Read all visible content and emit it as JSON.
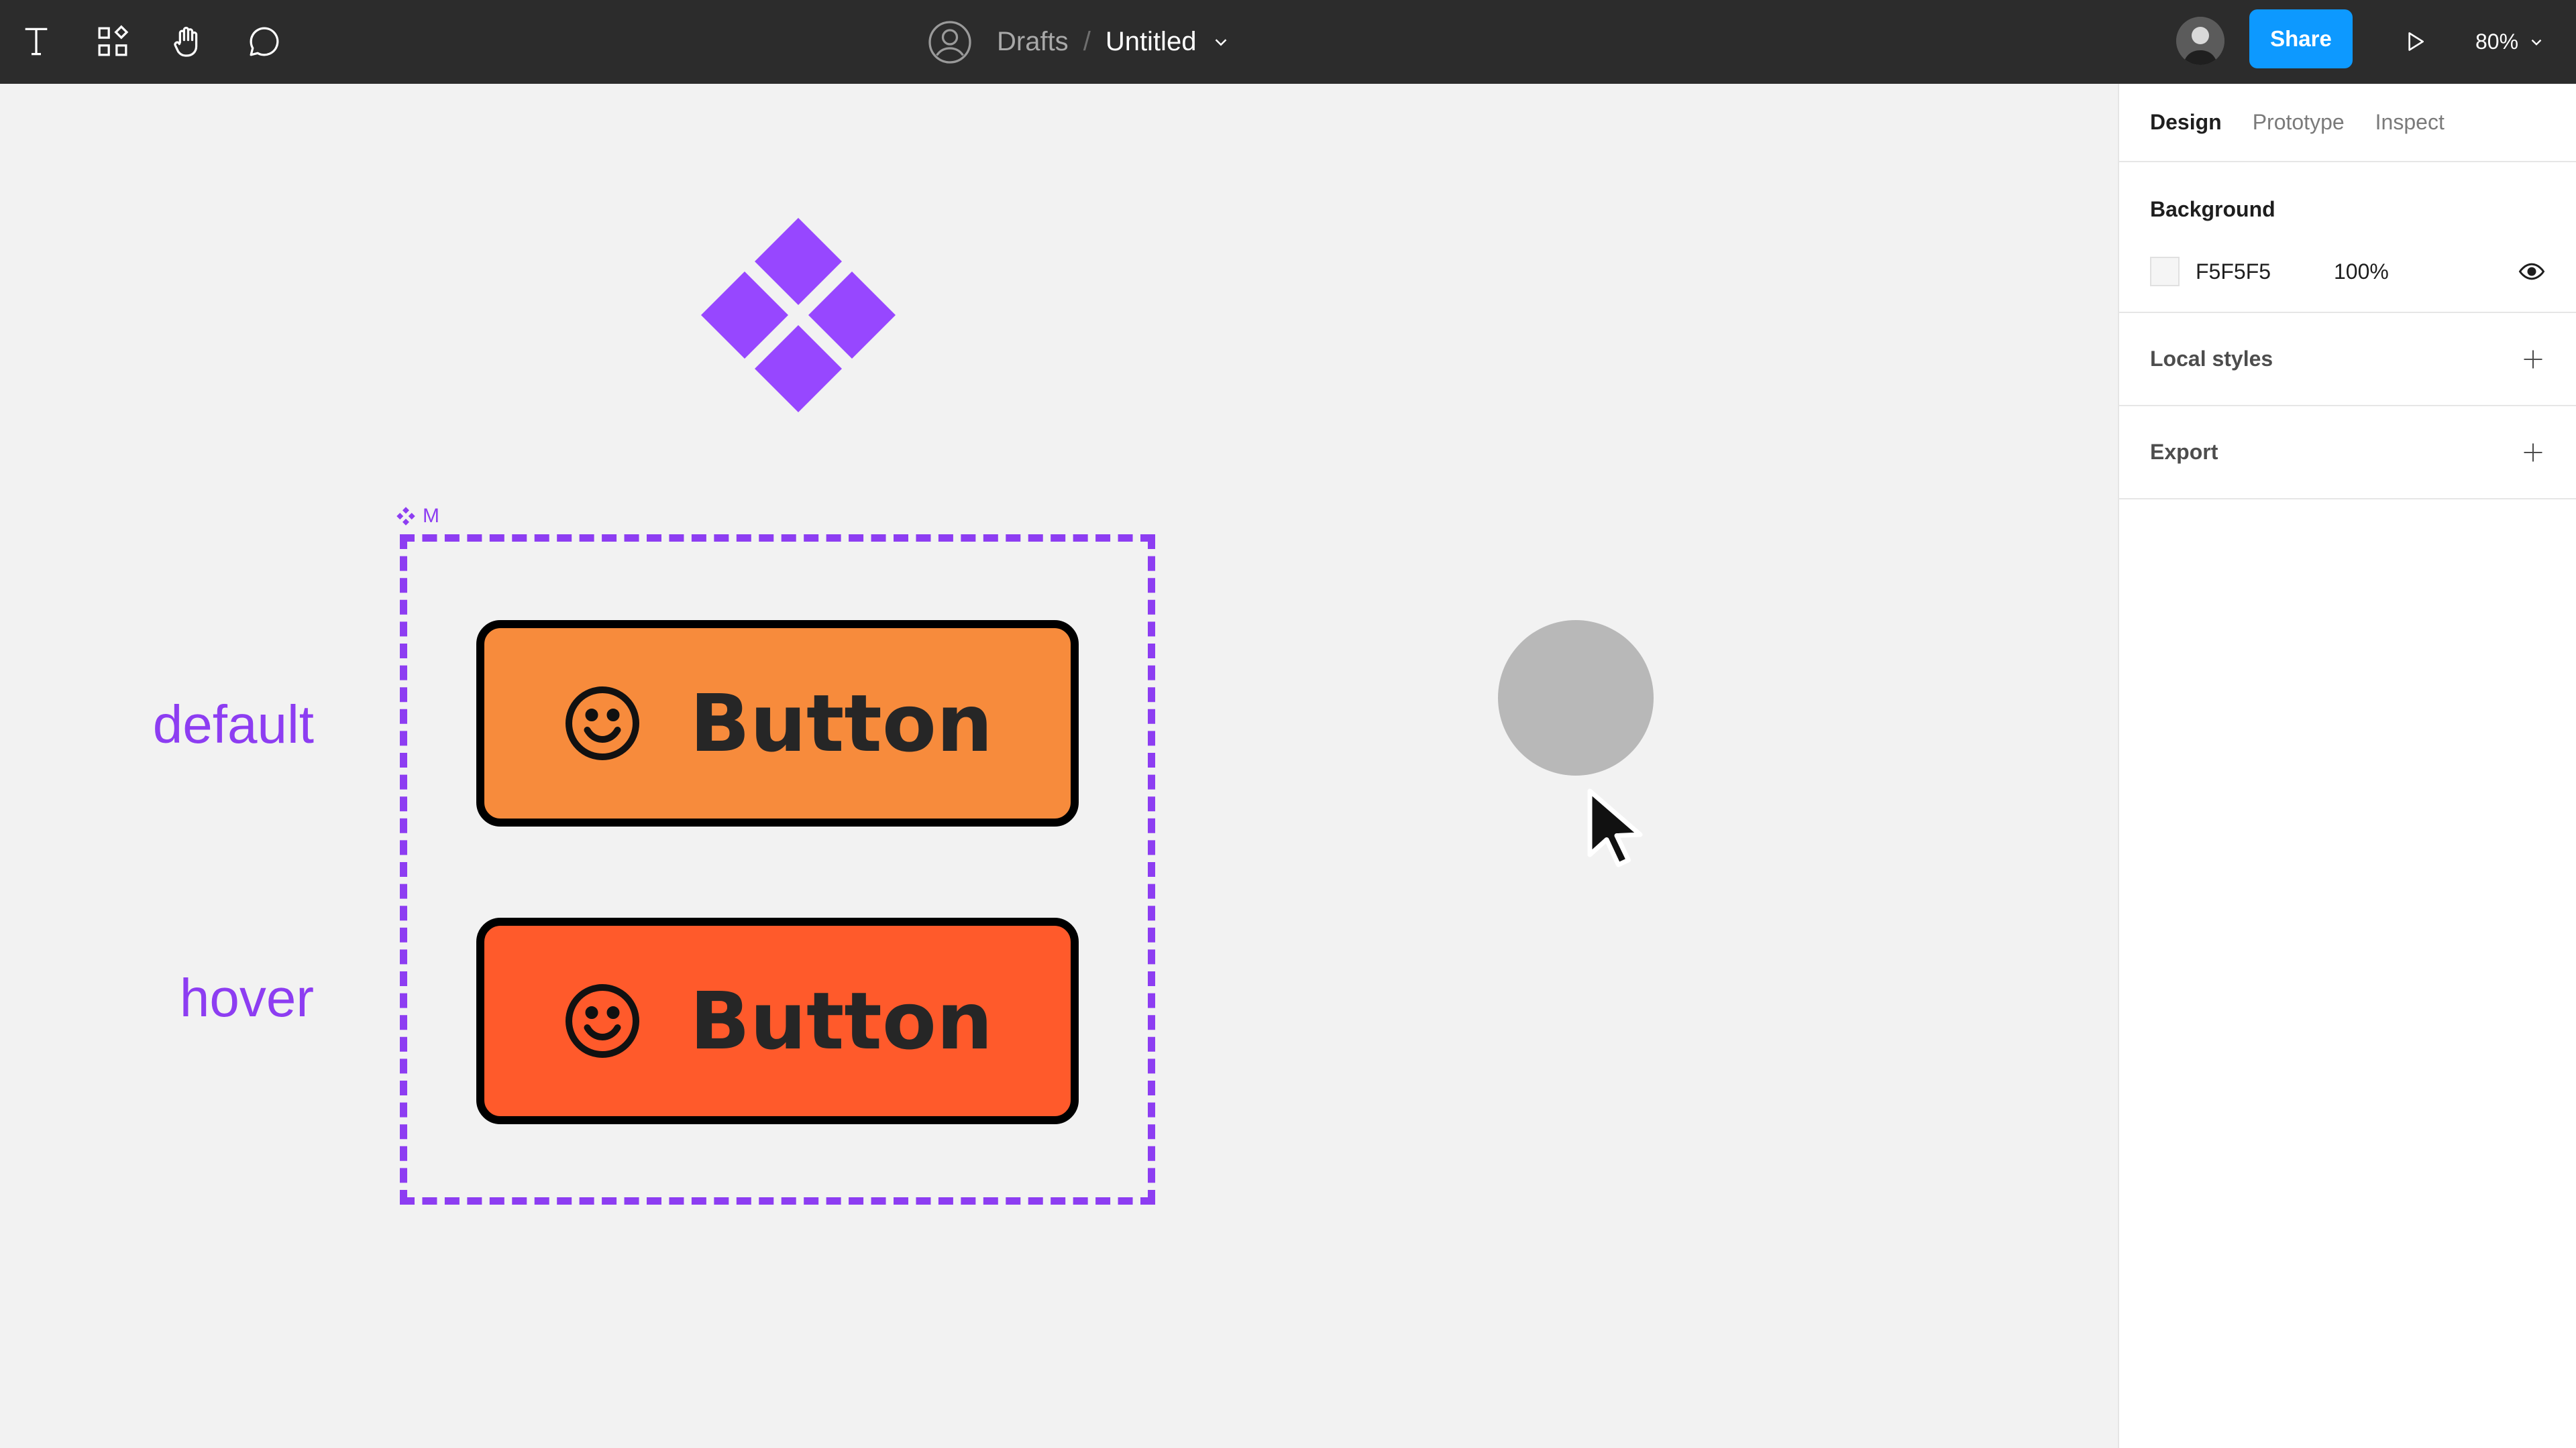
{
  "toolbar": {
    "tools": [
      {
        "icon": "text-tool-icon"
      },
      {
        "icon": "resources-icon"
      },
      {
        "icon": "hand-tool-icon"
      },
      {
        "icon": "comment-icon"
      }
    ],
    "breadcrumb": {
      "drafts": "Drafts",
      "separator": "/",
      "file_name": "Untitled"
    },
    "share_label": "Share",
    "zoom": "80%"
  },
  "canvas": {
    "frame_label": "M",
    "states": [
      {
        "label": "default",
        "button_text": "Button",
        "color": "#f78b3c"
      },
      {
        "label": "hover",
        "button_text": "Button",
        "color": "#ff5a2b"
      }
    ],
    "accent": "#8d3df2"
  },
  "panel": {
    "tabs": [
      "Design",
      "Prototype",
      "Inspect"
    ],
    "background": {
      "title": "Background",
      "hex": "F5F5F5",
      "opacity": "100%"
    },
    "local_styles": "Local styles",
    "export": "Export"
  }
}
